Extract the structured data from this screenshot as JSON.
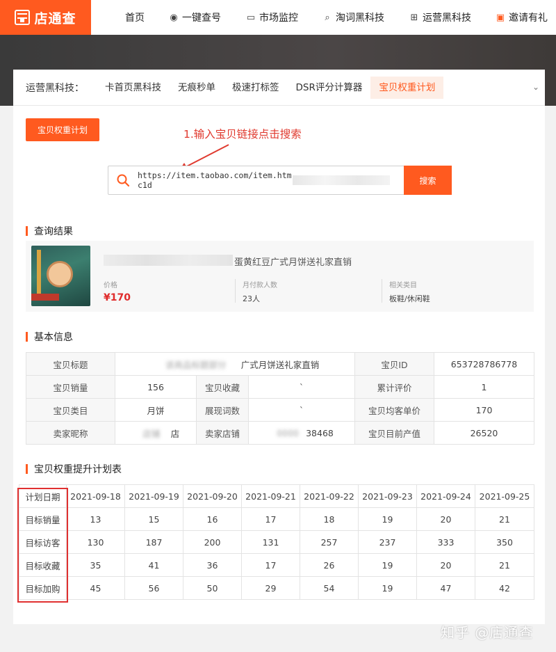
{
  "nav": {
    "logo": "店通查",
    "items": [
      {
        "label": "首页",
        "icon": ""
      },
      {
        "label": "一键查号",
        "icon": "eye-icon"
      },
      {
        "label": "市场监控",
        "icon": "monitor-icon"
      },
      {
        "label": "淘词黑科技",
        "icon": "search-tag-icon"
      },
      {
        "label": "运营黑科技",
        "icon": "grid-icon"
      },
      {
        "label": "邀请有礼",
        "icon": "gift-icon"
      }
    ]
  },
  "subnav": {
    "title": "运营黑科技：",
    "tabs": [
      "卡首页黑科技",
      "无痕秒单",
      "极速打标签",
      "DSR评分计算器",
      "宝贝权重计划"
    ],
    "active_index": 4
  },
  "plan_button": "宝贝权重计划",
  "annotation": "1.输入宝贝链接点击搜索",
  "search": {
    "value_prefix": "https://item.taobao.com/item.htm",
    "value_suffix": "c1d",
    "button": "搜索"
  },
  "result": {
    "heading": "查询结果",
    "title": "蛋黄红豆广式月饼送礼家直销",
    "price_label": "价格",
    "price": "¥170",
    "monthly_label": "月付款人数",
    "monthly": "23人",
    "category_label": "相关类目",
    "category": "板鞋/休闲鞋"
  },
  "basic": {
    "heading": "基本信息",
    "rows": [
      {
        "k1": "宝贝标题",
        "v1": "广式月饼送礼家直销",
        "k2": "宝贝ID",
        "v2": "653728786778"
      },
      {
        "k1": "宝贝销量",
        "v1": "156",
        "k2": "宝贝收藏",
        "v2": "`",
        "k3": "累计评价",
        "v3": "1"
      },
      {
        "k1": "宝贝类目",
        "v1": "月饼",
        "k2": "展现词数",
        "v2": "`",
        "k3": "宝贝均客单价",
        "v3": "170"
      },
      {
        "k1": "卖家昵称",
        "v1": "店",
        "k2": "卖家店铺",
        "v2": "38468",
        "k3": "宝贝目前产值",
        "v3": "26520"
      }
    ]
  },
  "plan": {
    "heading": "宝贝权重提升计划表",
    "header_label": "计划日期",
    "dates": [
      "2021-09-18",
      "2021-09-19",
      "2021-09-20",
      "2021-09-21",
      "2021-09-22",
      "2021-09-23",
      "2021-09-24",
      "2021-09-25"
    ],
    "rows": [
      {
        "label": "目标销量",
        "values": [
          "13",
          "15",
          "16",
          "17",
          "18",
          "19",
          "20",
          "21"
        ]
      },
      {
        "label": "目标访客",
        "values": [
          "130",
          "187",
          "200",
          "131",
          "257",
          "237",
          "333",
          "350"
        ]
      },
      {
        "label": "目标收藏",
        "values": [
          "35",
          "41",
          "36",
          "17",
          "26",
          "19",
          "20",
          "21"
        ]
      },
      {
        "label": "目标加购",
        "values": [
          "45",
          "56",
          "50",
          "29",
          "54",
          "19",
          "47",
          "42"
        ]
      }
    ]
  },
  "watermark": "知乎 @店通查"
}
